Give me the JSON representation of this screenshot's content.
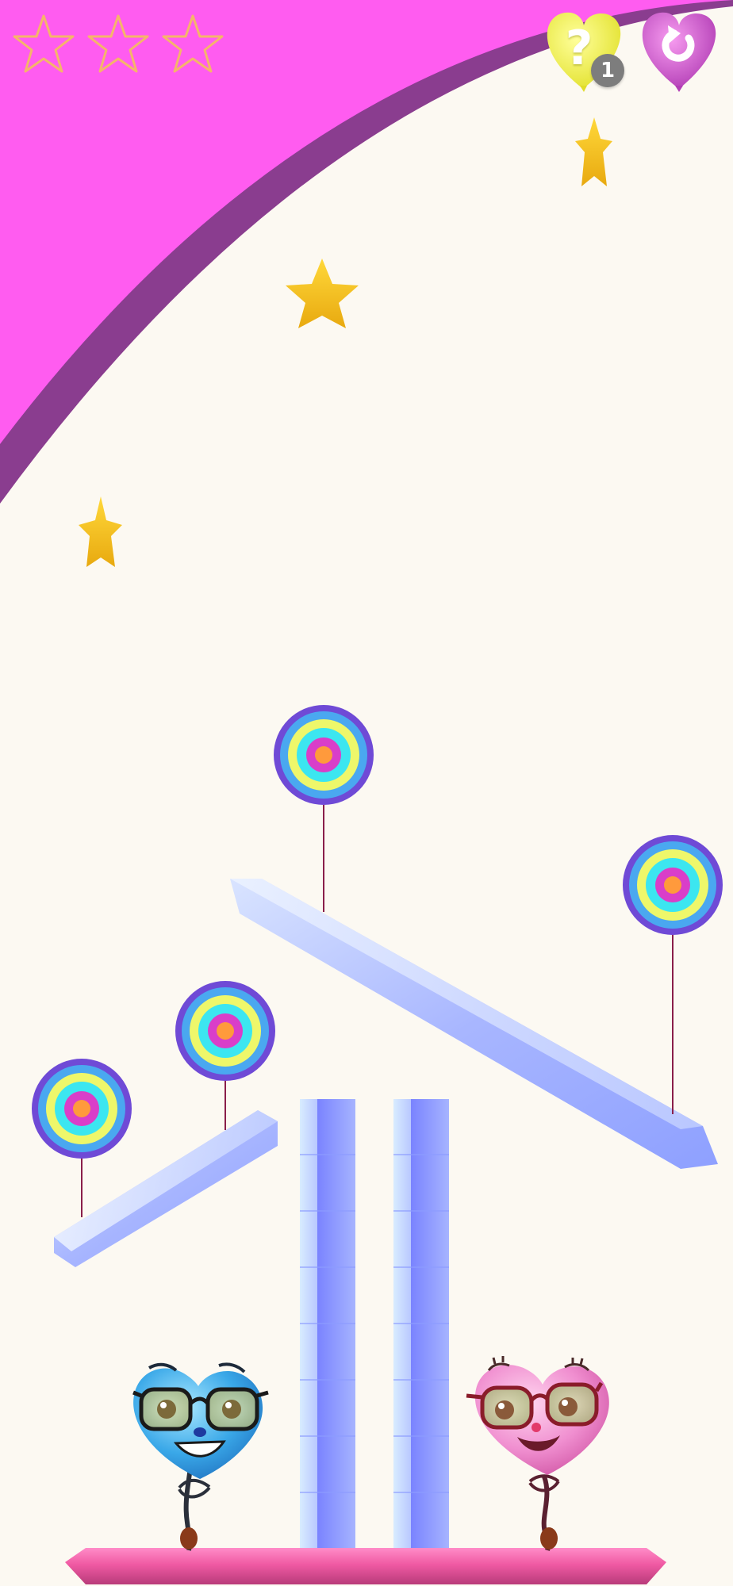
{
  "hud": {
    "stars_total": 3,
    "stars_collected": 0,
    "hint_label": "?",
    "hint_count": "1",
    "hint_icon": "question-heart-icon",
    "restart_icon": "restart-heart-icon"
  },
  "level": {
    "collectible_stars": 3,
    "lollipop_balloons": 4,
    "characters": [
      {
        "name": "blue-heart-balloon",
        "color": "#3aa8e8"
      },
      {
        "name": "pink-heart-balloon",
        "color": "#f06ec0"
      }
    ]
  },
  "colors": {
    "background": "#fcf9f2",
    "top_band": "#ff5cf0",
    "band_edge": "#8a3d8f",
    "star_gold": "#f5c21b",
    "ice": "#a9b8ff",
    "floor": "#f26aaa",
    "hint_heart": "#f4f24a",
    "restart_heart": "#d54fd0"
  }
}
